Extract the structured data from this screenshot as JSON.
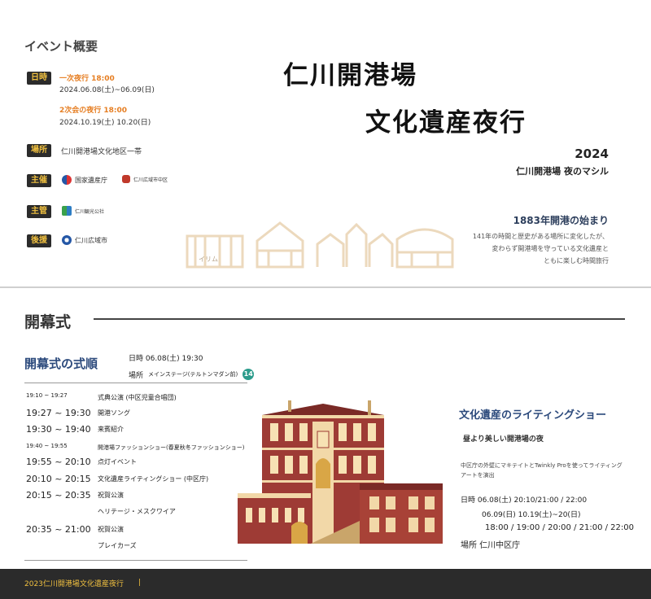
{
  "overview": {
    "section_title": "イベント概要",
    "date_tag": "日時",
    "night1_label": "一次夜行 18:00",
    "night1_dates": "2024.06.08(土)~06.09(日)",
    "night2_label": "2次会の夜行 18:00",
    "night2_dates": "2024.10.19(土) 10.20(日)",
    "place_tag": "場所",
    "place_value": "仁川開港場文化地区一帯",
    "host_tag": "主催",
    "host_logo1": "国家遺産庁",
    "host_logo2": "仁川広域市中区",
    "org_tag": "主管",
    "org_logo": "仁川観光公社",
    "support_tag": "後援",
    "support_logo": "仁川広域市"
  },
  "hero": {
    "title_line1": "仁川開港場",
    "title_line2": "文化遺産夜行",
    "year": "2024",
    "subtitle": "仁川開港場 夜のマシル",
    "history_title": "1883年開港の始まり",
    "history_line1": "141年の時間と歴史がある場所に変化したが、",
    "history_line2": "変わらず開港場を守っている文化遺産と",
    "history_line3": "ともに楽しむ時間旅行",
    "brand_small": "イリム"
  },
  "opening": {
    "section_title": "開幕式",
    "order_title": "開幕式の式順",
    "date_line": "日時 06.08(土) 19:30",
    "place_label": "場所",
    "place_value": "メインステージ(テルトンマダン前)",
    "place_badge": "14",
    "schedule": [
      {
        "time": "19:10 ~ 19:27",
        "event": "式典公演 (中区児童合唱団)",
        "size": "sm"
      },
      {
        "time": "19:27 ~ 19:30",
        "event": "開港ソング",
        "size": "big"
      },
      {
        "time": "19:30 ~ 19:40",
        "event": "来賓紹介",
        "size": "big"
      },
      {
        "time": "19:40 ~ 19:55",
        "event": "開港場ファッションショー(春夏秋冬ファッションショー)",
        "size": "xs"
      },
      {
        "time": "19:55 ~ 20:10",
        "event": "点灯イベント",
        "size": "big"
      },
      {
        "time": "20:10 ~ 20:15",
        "event": "文化遺産ライティングショー (中区庁)",
        "size": "big"
      },
      {
        "time": "20:15 ~ 20:35",
        "event": "祝賀公演",
        "size": "big"
      },
      {
        "time": "",
        "event": "ヘリテージ・メスクワイア",
        "size": "big"
      },
      {
        "time": "20:35 ~ 21:00",
        "event": "祝賀公演",
        "size": "big"
      },
      {
        "time": "",
        "event": "プレイカーズ",
        "size": "big"
      }
    ]
  },
  "lighting": {
    "title": "文化遺産のライティングショー",
    "subtitle": "昼より美しい開港場の夜",
    "desc_line1": "中区庁の外壁にマキテイトとTwinkly Proを使ってライティング",
    "desc_line2": "アートを演出",
    "date_line1": "日時 06.08(土) 20:10/21:00 / 22:00",
    "date_line2": "06.09(日) 10.19(土)~20(日)",
    "date_line3": "18:00 / 19:00 / 20:00 / 21:00 / 22:00",
    "place_line": "場所  仁川中区庁"
  },
  "footer": {
    "text": "2023仁川開港場文化遺産夜行",
    "bar": "|"
  },
  "colors": {
    "accent_blue": "#2c4a7c",
    "accent_orange": "#e67e22",
    "tag_bg": "#2b2b2b",
    "tag_text": "#f0c040",
    "building_brick": "#9e3b35",
    "building_cream": "#f2d8a8"
  }
}
